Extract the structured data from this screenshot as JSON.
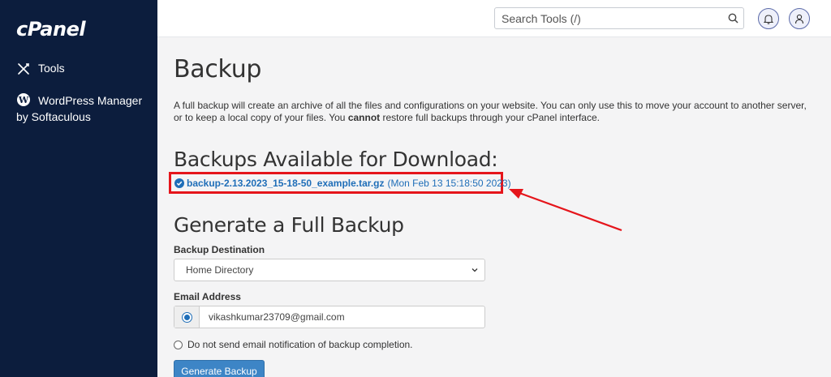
{
  "sidebar": {
    "logo": "cPanel",
    "items": [
      {
        "label": "Tools",
        "icon": "tools-icon"
      },
      {
        "label": "WordPress Manager",
        "sub": "by Softaculous",
        "icon": "wordpress-icon"
      }
    ]
  },
  "header": {
    "search_placeholder": "Search Tools (/)"
  },
  "main": {
    "title": "Backup",
    "description_part1": "A full backup will create an archive of all the files and configurations on your website. You can only use this to move your account to another server, or to keep a local copy of your files. You ",
    "description_bold": "cannot",
    "description_part2": " restore full backups through your cPanel interface.",
    "available_heading": "Backups Available for Download:",
    "backup_file": "backup-2.13.2023_15-18-50_example.tar.gz",
    "backup_date": "(Mon Feb 13 15:18:50 2023)",
    "generate_heading": "Generate a Full Backup",
    "destination_label": "Backup Destination",
    "destination_value": "Home Directory",
    "email_label": "Email Address",
    "email_value": "vikashkumar23709@gmail.com",
    "no_email_option": "Do not send email notification of backup completion.",
    "generate_button": "Generate Backup"
  },
  "colors": {
    "sidebar_bg": "#0c1d3d",
    "link": "#1f6eb8",
    "annotation": "#e5151b",
    "button": "#3d85c6"
  }
}
